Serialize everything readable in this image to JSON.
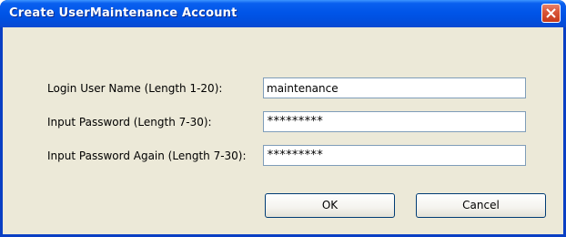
{
  "window": {
    "title": "Create UserMaintenance Account",
    "close_icon": "close-icon"
  },
  "form": {
    "login": {
      "label": "Login User Name (Length 1-20):",
      "value": "maintenance"
    },
    "password": {
      "label": "Input Password (Length 7-30):",
      "value": "*********"
    },
    "password_again": {
      "label": "Input Password Again (Length 7-30):",
      "value": "*********"
    }
  },
  "buttons": {
    "ok_label": "OK",
    "cancel_label": "Cancel"
  },
  "colors": {
    "titlebar": "#0055e8",
    "client_bg": "#ece9d8",
    "close_button": "#d9573a",
    "field_border": "#7f9db9",
    "button_border": "#003c74"
  }
}
